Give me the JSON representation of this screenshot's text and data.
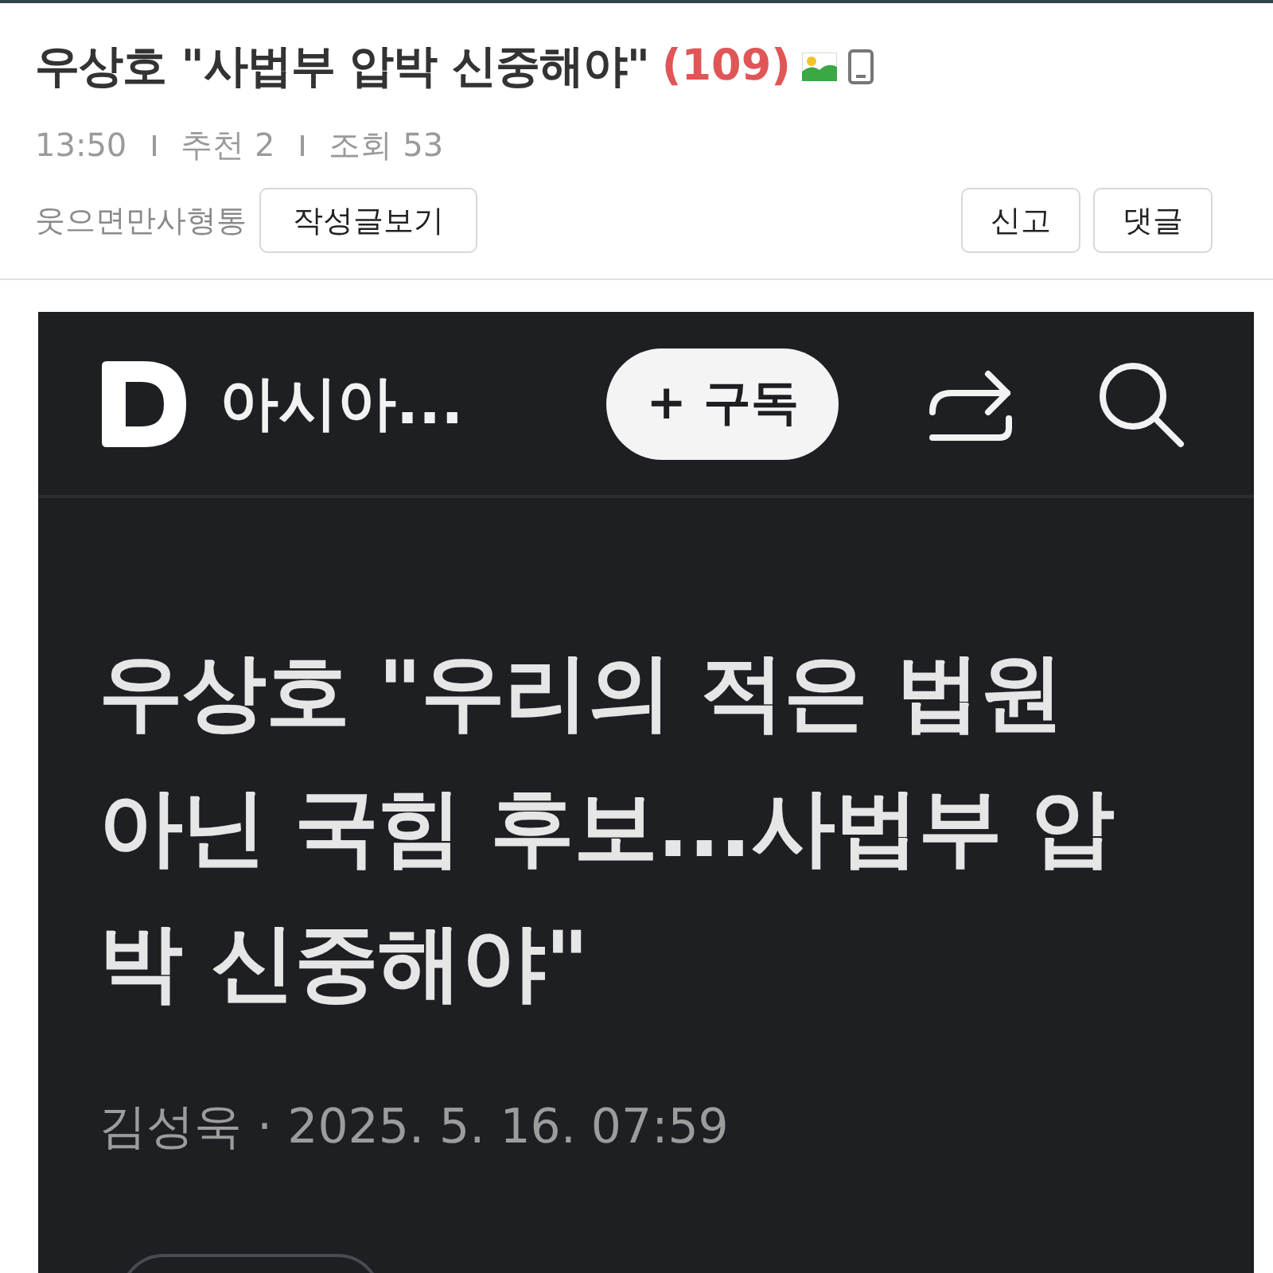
{
  "post": {
    "title": "우상호 \"사법부 압박 신중해야\"",
    "comment_count": "(109)"
  },
  "meta": [
    "13:50",
    "추천 2",
    "조회 53"
  ],
  "author": {
    "name": "웃으면만사형통",
    "button": "작성글보기"
  },
  "actions": [
    "신고",
    "댓글"
  ],
  "embedded_screenshot": {
    "nav": {
      "site": "아시아...",
      "subscribe": "+ 구독"
    },
    "headline": "우상호 \"우리의 적은 법원 아닌 국힘 후보...사법부 압박 신중해야\"",
    "byline": "김성욱 · 2025. 5. 16. 07:59"
  }
}
